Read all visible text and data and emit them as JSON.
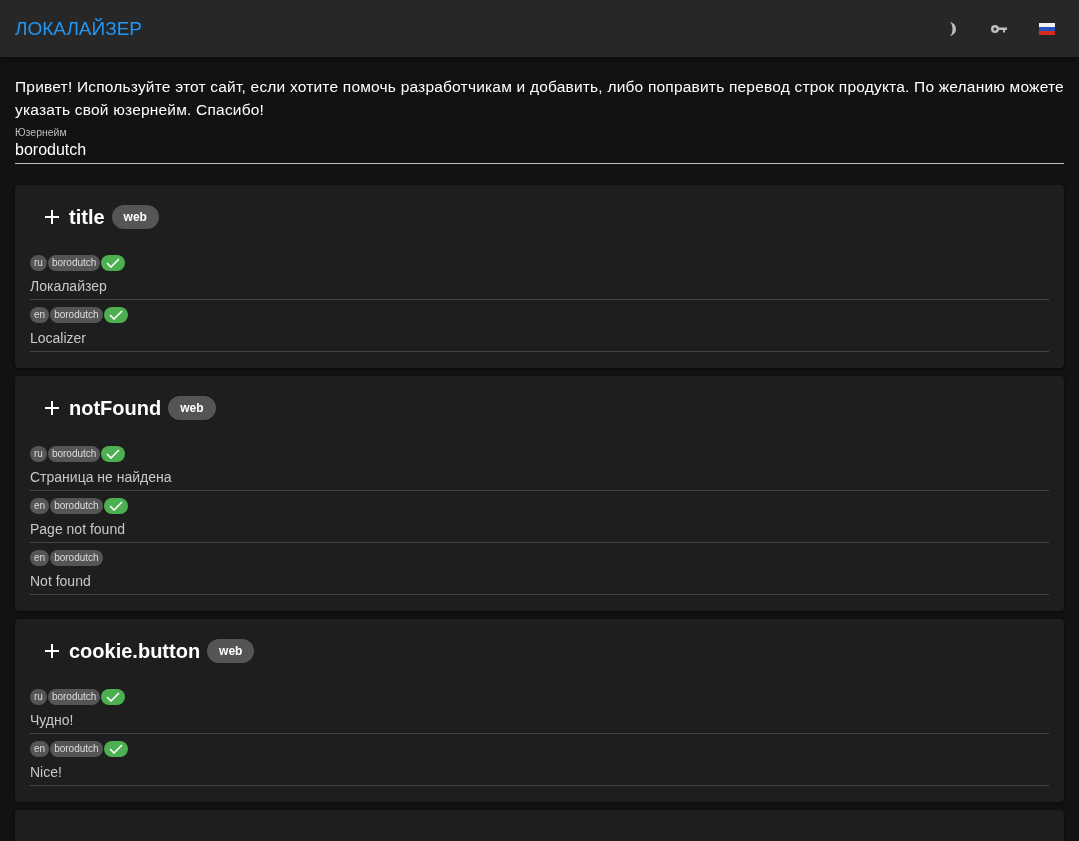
{
  "app_bar": {
    "title": "ЛОКАЛАЙЗЕР"
  },
  "intro": "Привет! Используйте этот сайт, если хотите помочь разработчикам и добавить, либо поправить перевод строк продукта. По желанию можете указать свой юзернейм. Спасибо!",
  "username_field": {
    "label": "Юзернейм",
    "value": "borodutch"
  },
  "entries": [
    {
      "key": "title",
      "tag": "web",
      "translations": [
        {
          "lang": "ru",
          "user": "borodutch",
          "approved": true,
          "text": "Локалайзер"
        },
        {
          "lang": "en",
          "user": "borodutch",
          "approved": true,
          "text": "Localizer"
        }
      ]
    },
    {
      "key": "notFound",
      "tag": "web",
      "translations": [
        {
          "lang": "ru",
          "user": "borodutch",
          "approved": true,
          "text": "Страница не найдена"
        },
        {
          "lang": "en",
          "user": "borodutch",
          "approved": true,
          "text": "Page not found"
        },
        {
          "lang": "en",
          "user": "borodutch",
          "approved": false,
          "text": "Not found"
        }
      ]
    },
    {
      "key": "cookie.button",
      "tag": "web",
      "translations": [
        {
          "lang": "ru",
          "user": "borodutch",
          "approved": true,
          "text": "Чудно!"
        },
        {
          "lang": "en",
          "user": "borodutch",
          "approved": true,
          "text": "Nice!"
        }
      ]
    }
  ]
}
